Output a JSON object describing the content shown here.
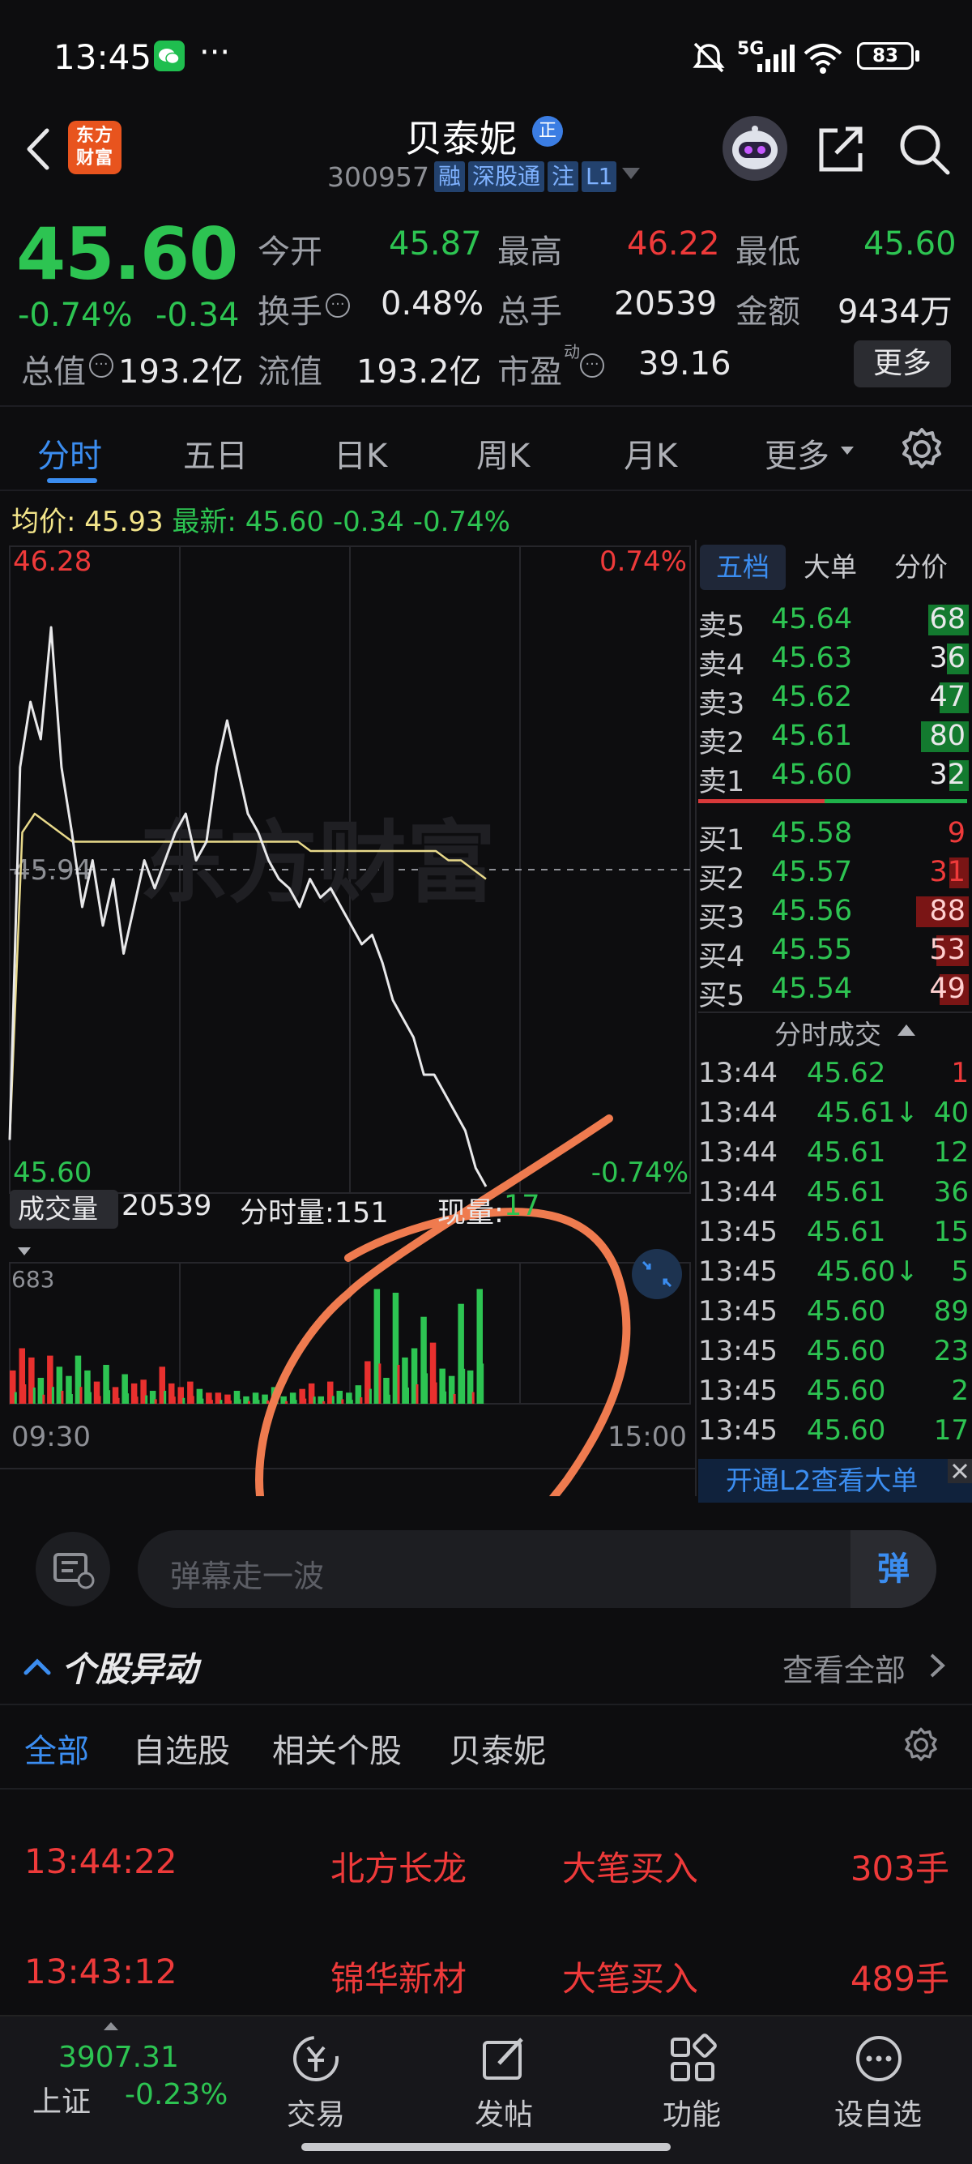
{
  "status_bar": {
    "time": "13:45",
    "dots": "···",
    "network": "5G",
    "battery": "83"
  },
  "header": {
    "brand_logo": "东方财富",
    "stock_name": "贝泰妮",
    "name_badge": "正",
    "code": "300957",
    "tags": [
      "融",
      "深股通",
      "注",
      "L1"
    ]
  },
  "quote": {
    "price": "45.60",
    "change_pct": "-0.74%",
    "change": "-0.34",
    "open_label": "今开",
    "open": "45.87",
    "high_label": "最高",
    "high": "46.22",
    "low_label": "最低",
    "low": "45.60",
    "turnover_label": "换手",
    "turnover": "0.48%",
    "volume_label": "总手",
    "volume": "20539",
    "amount_label": "金额",
    "amount": "9434万",
    "mcap_label": "总值",
    "mcap": "193.2亿",
    "float_label": "流值",
    "float_mcap": "193.2亿",
    "pe_label": "市盈",
    "pe_sup": "动",
    "pe": "39.16",
    "more_button": "更多"
  },
  "tabs": [
    "分时",
    "五日",
    "日K",
    "周K",
    "月K",
    "更多"
  ],
  "info_line": {
    "avg_label": "均价:",
    "avg": "45.93",
    "latest_label": "最新:",
    "latest": "45.60",
    "chg": "-0.34",
    "chg_pct": "-0.74%"
  },
  "chart_data": {
    "type": "line",
    "y_top_label": "46.28",
    "y_bottom_label": "45.60",
    "pct_top_label": "0.74%",
    "pct_bottom_label": "-0.74%",
    "mid_label": "45.94",
    "ylim": [
      45.6,
      46.28
    ],
    "x_start_label": "09:30",
    "x_end_label": "15:00",
    "watermark": "东方财富",
    "price": [
      45.65,
      46.05,
      46.12,
      46.08,
      46.2,
      46.05,
      45.98,
      45.9,
      45.95,
      45.88,
      45.93,
      45.85,
      45.9,
      45.95,
      45.92,
      45.95,
      45.98,
      46.0,
      45.95,
      45.97,
      46.05,
      46.1,
      46.05,
      46.0,
      45.98,
      45.95,
      45.93,
      45.92,
      45.9,
      45.93,
      45.91,
      45.92,
      45.9,
      45.88,
      45.86,
      45.87,
      45.84,
      45.8,
      45.78,
      45.76,
      45.72,
      45.72,
      45.7,
      45.68,
      45.66,
      45.62,
      45.6
    ],
    "avg": [
      45.65,
      45.98,
      46.0,
      45.99,
      45.98,
      45.97,
      45.97,
      45.97,
      45.97,
      45.97,
      45.97,
      45.97,
      45.97,
      45.97,
      45.97,
      45.97,
      45.97,
      45.97,
      45.97,
      45.97,
      45.97,
      45.97,
      45.97,
      45.97,
      45.96,
      45.96,
      45.96,
      45.96,
      45.96,
      45.96,
      45.96,
      45.96,
      45.96,
      45.96,
      45.96,
      45.95,
      45.95,
      45.94,
      45.93
    ],
    "volume_max_label": "683",
    "volume": [
      180,
      300,
      250,
      140,
      260,
      200,
      150,
      260,
      180,
      120,
      210,
      90,
      160,
      110,
      130,
      70,
      200,
      110,
      90,
      120,
      80,
      60,
      60,
      50,
      70,
      40,
      60,
      50,
      90,
      40,
      60,
      80,
      110,
      40,
      120,
      70,
      60,
      100,
      230,
      620,
      140,
      600,
      250,
      300,
      470,
      330,
      190,
      150,
      540,
      180,
      620
    ]
  },
  "volume_bar_info": {
    "vol_label": "成交量",
    "vol": "20539",
    "tick_vol_label": "分时量:151",
    "now_label": "现量:",
    "now": "17"
  },
  "orderbook": {
    "tabs": [
      "五档",
      "大单",
      "分价"
    ],
    "asks": [
      {
        "label": "卖5",
        "price": "45.64",
        "vol": "68",
        "fill": 0.55
      },
      {
        "label": "卖4",
        "price": "45.63",
        "vol": "36",
        "fill": 0.3
      },
      {
        "label": "卖3",
        "price": "45.62",
        "vol": "47",
        "fill": 0.4
      },
      {
        "label": "卖2",
        "price": "45.61",
        "vol": "80",
        "fill": 0.65
      },
      {
        "label": "卖1",
        "price": "45.60",
        "vol": "32",
        "fill": 0.27
      }
    ],
    "bids": [
      {
        "label": "买1",
        "price": "45.58",
        "vol": "9",
        "fill": 0.0
      },
      {
        "label": "买2",
        "price": "45.57",
        "vol": "31",
        "fill": 0.27
      },
      {
        "label": "买3",
        "price": "45.56",
        "vol": "88",
        "fill": 0.72
      },
      {
        "label": "买4",
        "price": "45.55",
        "vol": "53",
        "fill": 0.44
      },
      {
        "label": "买5",
        "price": "45.54",
        "vol": "49",
        "fill": 0.4
      }
    ],
    "ticks_title": "分时成交",
    "ticks": [
      {
        "t": "13:44",
        "p": "45.62",
        "v": "1",
        "arrow": "",
        "vc": "red"
      },
      {
        "t": "13:44",
        "p": "45.61",
        "v": "40",
        "arrow": "↓",
        "vc": "green"
      },
      {
        "t": "13:44",
        "p": "45.61",
        "v": "12",
        "arrow": "",
        "vc": "green"
      },
      {
        "t": "13:44",
        "p": "45.61",
        "v": "36",
        "arrow": "",
        "vc": "green"
      },
      {
        "t": "13:45",
        "p": "45.61",
        "v": "15",
        "arrow": "",
        "vc": "green"
      },
      {
        "t": "13:45",
        "p": "45.60",
        "v": "5",
        "arrow": "↓",
        "vc": "green"
      },
      {
        "t": "13:45",
        "p": "45.60",
        "v": "89",
        "arrow": "",
        "vc": "green"
      },
      {
        "t": "13:45",
        "p": "45.60",
        "v": "23",
        "arrow": "",
        "vc": "green"
      },
      {
        "t": "13:45",
        "p": "45.60",
        "v": "2",
        "arrow": "",
        "vc": "green"
      },
      {
        "t": "13:45",
        "p": "45.60",
        "v": "17",
        "arrow": "",
        "vc": "green"
      }
    ],
    "l2_banner": "开通L2查看大单"
  },
  "danmu": {
    "placeholder": "弹幕走一波",
    "button": "弹"
  },
  "movers": {
    "title": "个股异动",
    "view_all": "查看全部",
    "filters": [
      "全部",
      "自选股",
      "相关个股",
      "贝泰妮"
    ],
    "rows": [
      {
        "time": "13:44:22",
        "name": "北方长龙",
        "event": "大笔买入",
        "amount": "303手"
      },
      {
        "time": "13:43:12",
        "name": "锦华新材",
        "event": "大笔买入",
        "amount": "489手"
      }
    ]
  },
  "bottom_nav": {
    "index_value": "3907.31",
    "index_name": "上证",
    "index_chg": "-0.23%",
    "items": [
      "交易",
      "发帖",
      "功能",
      "设自选"
    ]
  }
}
